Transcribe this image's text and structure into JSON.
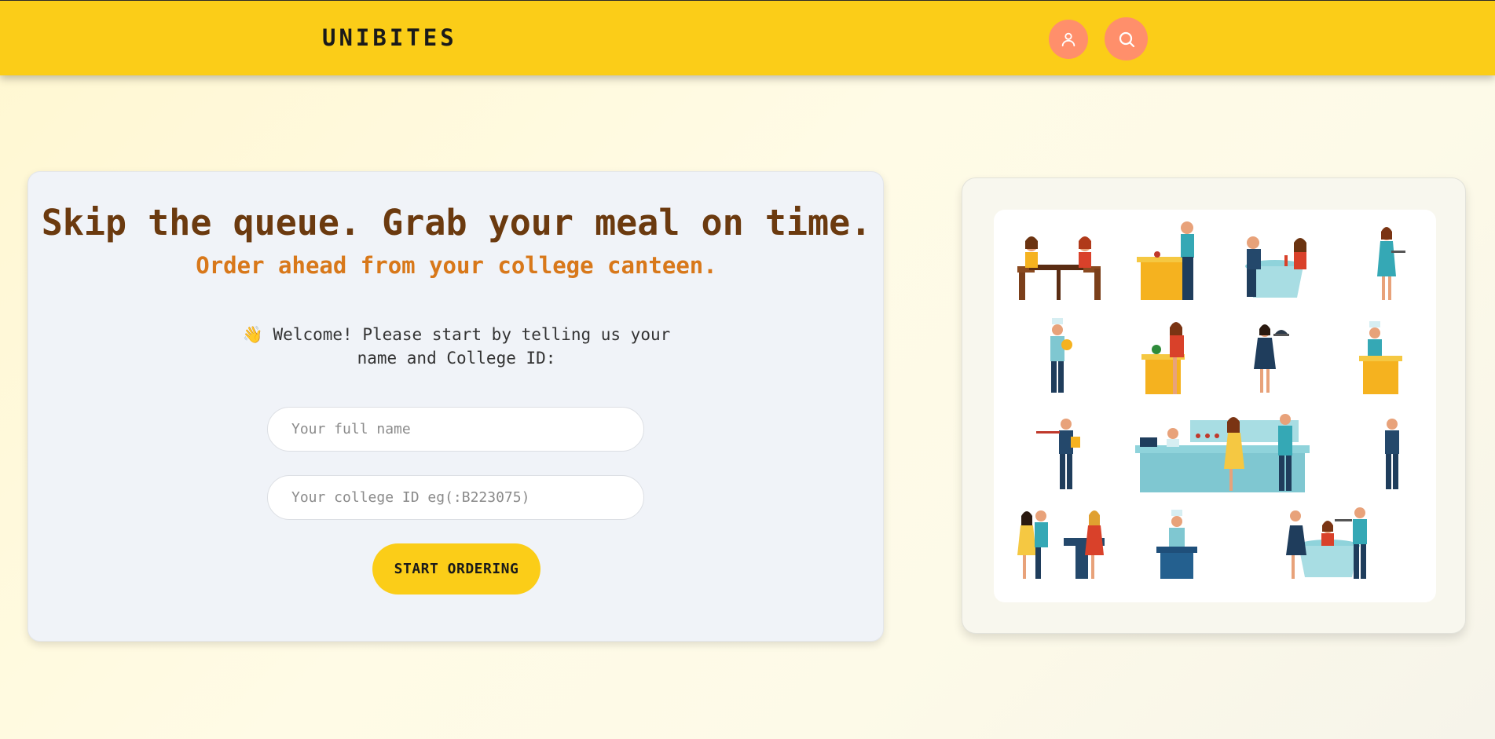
{
  "header": {
    "brand": "UNIBITES",
    "user_icon": "user-icon",
    "search_icon": "search-icon",
    "accent_color": "#fbcd18",
    "icon_button_color": "#ff8f6b"
  },
  "hero": {
    "headline": "Skip the queue. Grab your meal on time.",
    "subheadline": "Order ahead from your college canteen.",
    "welcome_emoji": "👋",
    "welcome_text": "Welcome! Please start by telling us your name and College ID:"
  },
  "form": {
    "name_placeholder": "Your full name",
    "name_value": "",
    "id_placeholder": "Your college ID eg(:B223075)",
    "id_value": "",
    "submit_label": "START ORDERING"
  },
  "illustration": {
    "icon": "restaurant-staff-illustration"
  }
}
